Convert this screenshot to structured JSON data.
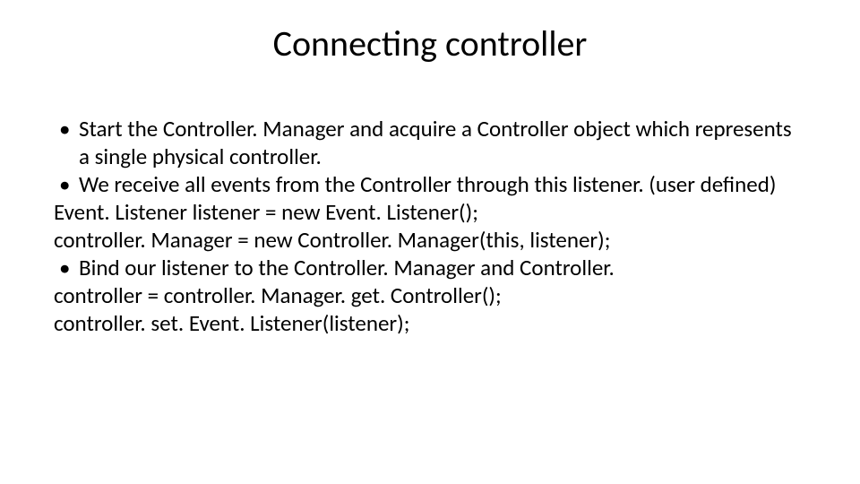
{
  "title": "Connecting controller",
  "bullets": {
    "b1": "Start the Controller. Manager and acquire a Controller object which represents a single physical controller.",
    "b2": "We receive all events from the Controller through this listener. (user defined)",
    "b3": "Bind our listener to the Controller. Manager and Controller."
  },
  "lines": {
    "l1": "Event. Listener listener = new Event. Listener();",
    "l2": "controller. Manager = new Controller. Manager(this, listener);",
    "l3": "controller = controller. Manager. get. Controller();",
    "l4": "controller. set. Event. Listener(listener);"
  },
  "marker": "•"
}
